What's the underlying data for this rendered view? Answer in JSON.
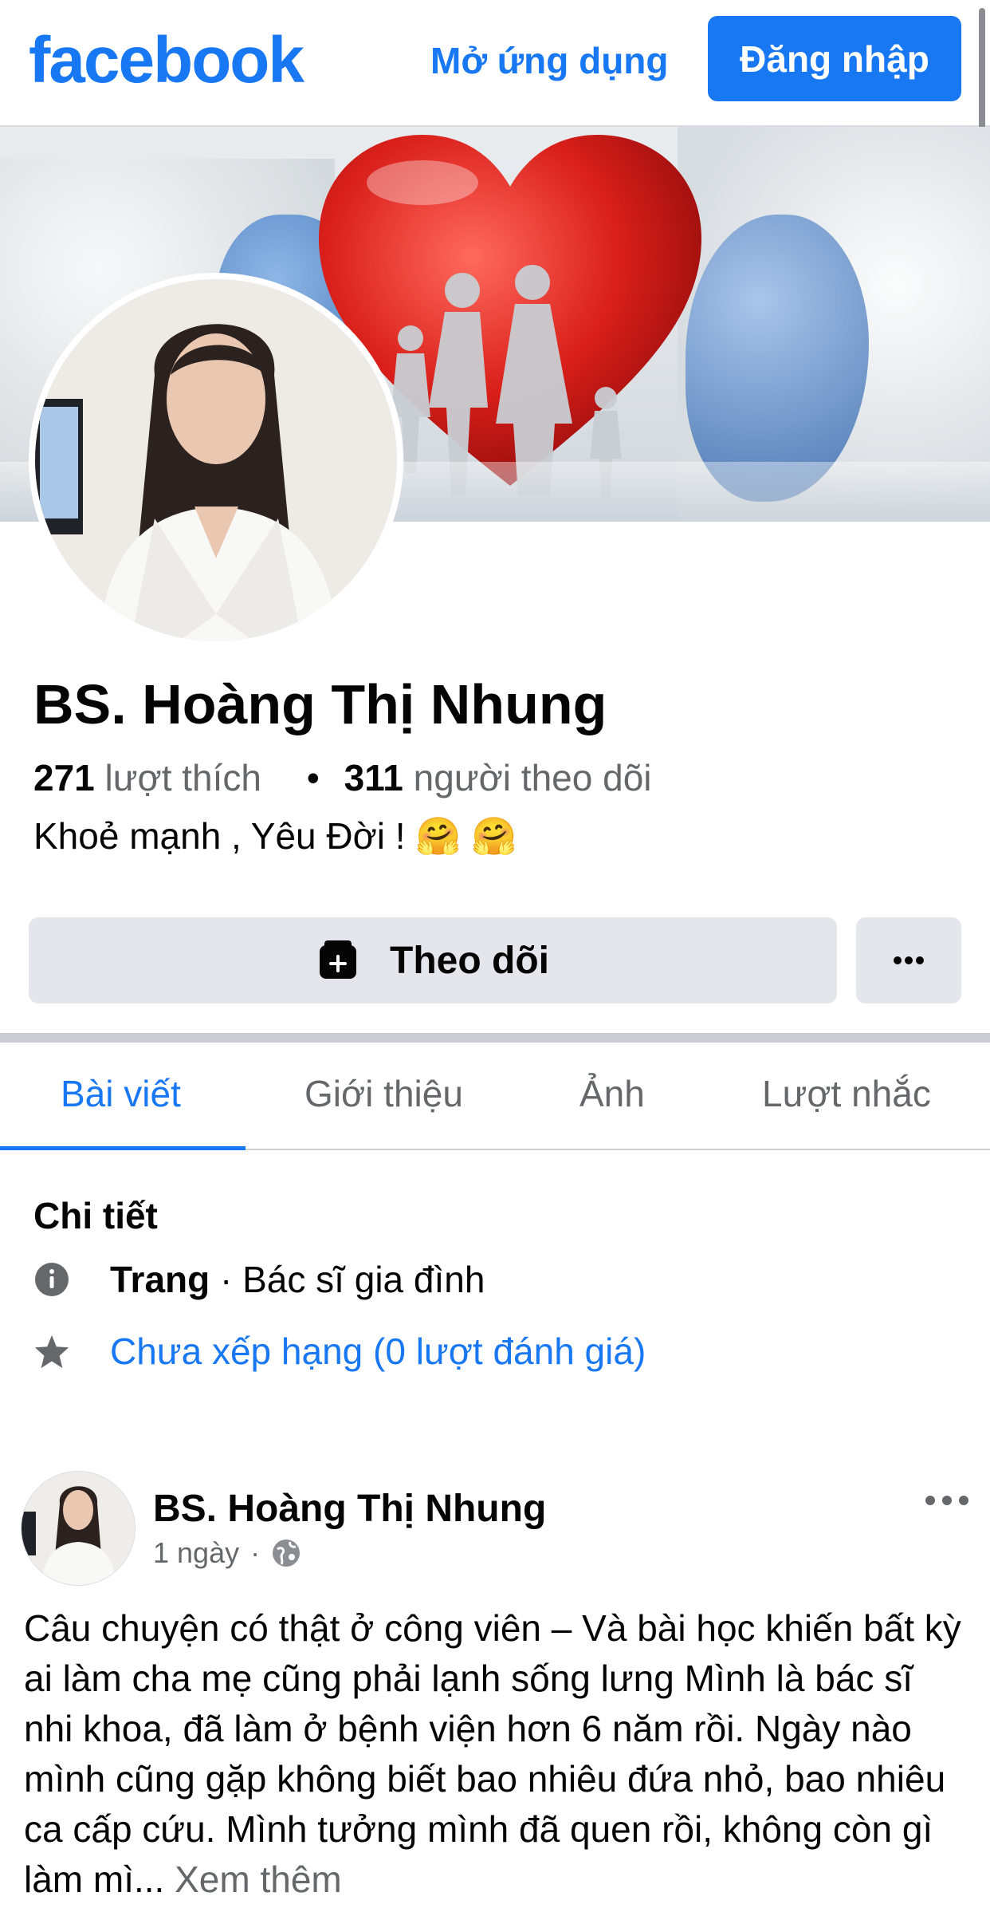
{
  "header": {
    "logo": "facebook",
    "open_app": "Mở ứng dụng",
    "login": "Đăng nhập"
  },
  "profile": {
    "name": "BS. Hoàng Thị Nhung",
    "likes_count": "271",
    "likes_label": "lượt thích",
    "separator": "•",
    "followers_count": "311",
    "followers_label": "người theo dõi",
    "bio": "Khoẻ mạnh , Yêu Đời ! 🤗 🤗",
    "follow_button": "Theo dõi",
    "more_button": "···"
  },
  "tabs": [
    "Bài viết",
    "Giới thiệu",
    "Ảnh",
    "Lượt nhắc"
  ],
  "details": {
    "title": "Chi tiết",
    "type_bold": "Trang",
    "type_rest": " · Bác sĩ gia đình",
    "rating": "Chưa xếp hạng (0 lượt đánh giá)"
  },
  "post": {
    "author": "BS. Hoàng Thị Nhung",
    "time": "1 ngày",
    "dot": "·",
    "text": "Câu chuyện có thật ở công viên – Và bài học khiến bất kỳ ai làm cha mẹ cũng phải lạnh sống lưng Mình là bác sĩ nhi khoa, đã làm ở bệnh viện hơn 6 năm rồi. Ngày nào mình cũng gặp không biết bao nhiêu đứa nhỏ, bao nhiêu ca cấp cứu. Mình tưởng mình đã quen rồi, không còn gì làm mì...",
    "see_more": "Xem thêm",
    "more_icon": "···"
  },
  "colors": {
    "brand": "#1877f2",
    "button_gray": "#e4e6eb",
    "secondary_text": "#65676b"
  },
  "icons": [
    "follow-icon",
    "info-icon",
    "star-icon",
    "globe-icon",
    "more-icon"
  ]
}
